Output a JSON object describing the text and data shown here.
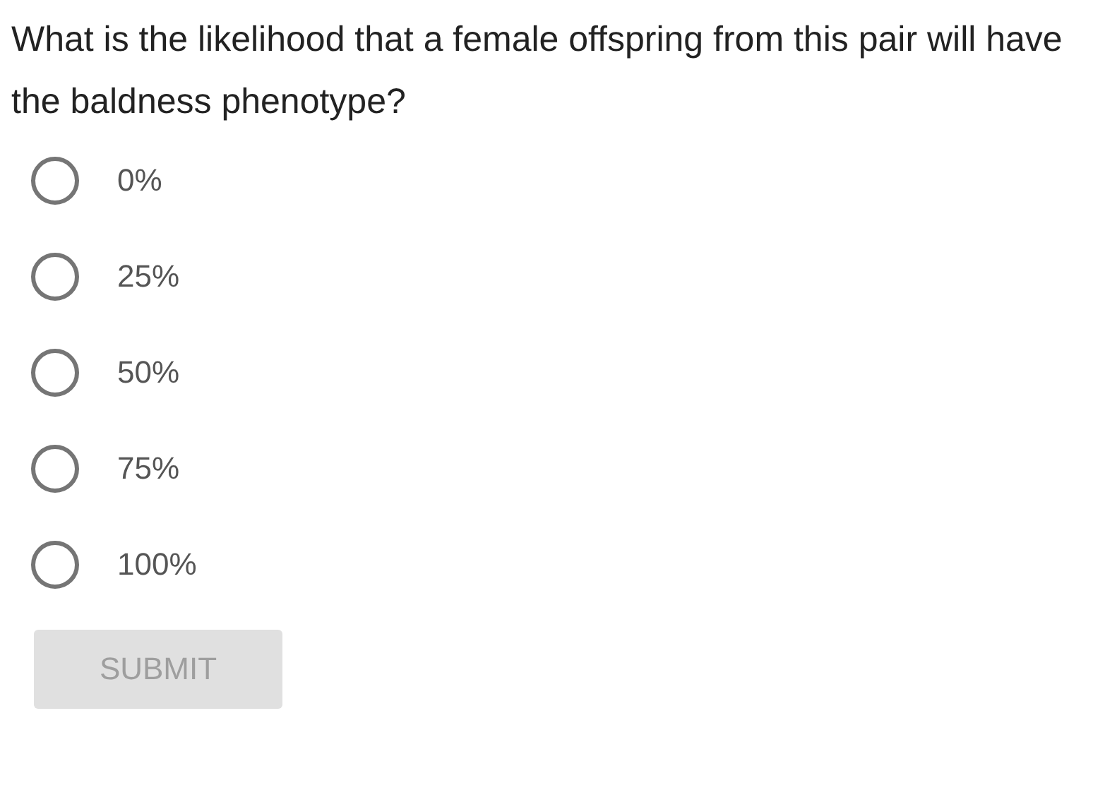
{
  "question": "What is the likelihood that a female offspring from this pair will have the baldness phenotype?",
  "options": [
    {
      "label": "0%",
      "selected": false
    },
    {
      "label": "25%",
      "selected": false
    },
    {
      "label": "50%",
      "selected": false
    },
    {
      "label": "75%",
      "selected": false
    },
    {
      "label": "100%",
      "selected": false
    }
  ],
  "submit": {
    "label": "SUBMIT",
    "disabled": true
  }
}
